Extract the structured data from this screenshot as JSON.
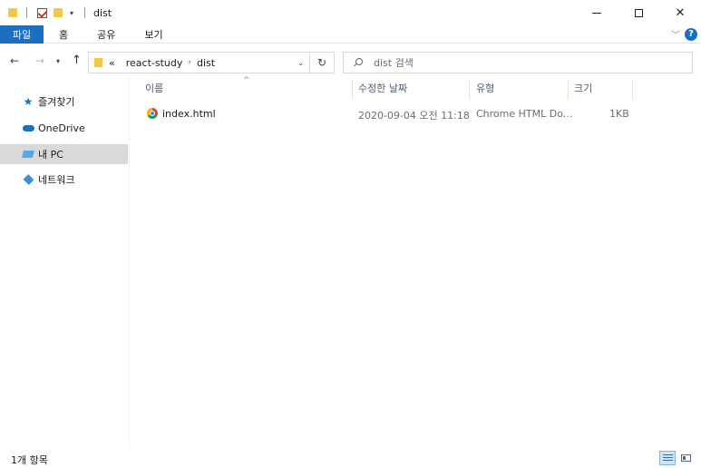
{
  "window": {
    "title": "dist",
    "minimize_label": "",
    "maximize_label": "",
    "close_label": "✕"
  },
  "ribbon": {
    "tabs": [
      "파일",
      "홈",
      "공유",
      "보기"
    ],
    "help_label": "?"
  },
  "address": {
    "overflow": "«",
    "crumbs": [
      "react-study",
      "dist"
    ]
  },
  "search": {
    "placeholder": "dist 검색"
  },
  "sidebar": {
    "items": [
      {
        "label": "즐겨찾기",
        "icon": "star-icon"
      },
      {
        "label": "OneDrive",
        "icon": "cloud-icon"
      },
      {
        "label": "내 PC",
        "icon": "pc-icon",
        "selected": true
      },
      {
        "label": "네트워크",
        "icon": "network-icon"
      }
    ]
  },
  "columns": {
    "name": "이름",
    "modified": "수정한 날짜",
    "type": "유형",
    "size": "크기"
  },
  "files": [
    {
      "name": "index.html",
      "modified": "2020-09-04 오전 11:18",
      "type": "Chrome HTML Do...",
      "size": "1KB",
      "icon": "chrome-icon"
    }
  ],
  "status": {
    "count": "1개 항목"
  },
  "colors": {
    "accent": "#1a6fc1",
    "selected_bg": "#d9d9d9",
    "header_text": "#4a5d7a"
  }
}
